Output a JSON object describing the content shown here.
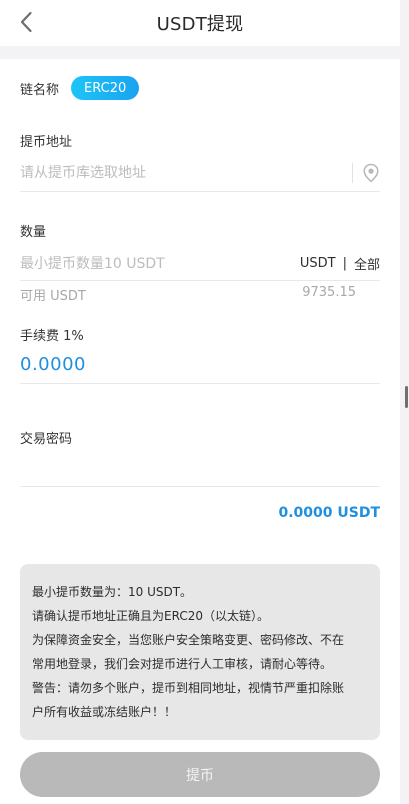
{
  "header": {
    "title": "USDT提现",
    "back_icon": "chevron-left-icon"
  },
  "chain": {
    "label": "链名称",
    "selected": "ERC20",
    "accent": "#1cb8f4"
  },
  "address": {
    "label": "提币地址",
    "placeholder": "请从提币库选取地址",
    "location_icon": "location-pin-icon"
  },
  "amount": {
    "label": "数量",
    "placeholder": "最小提币数量10 USDT",
    "currency": "USDT",
    "separator": "|",
    "all_label": "全部",
    "available_label": "可用 USDT",
    "available_value": "9735.15"
  },
  "fee": {
    "label": "手续费 1%",
    "value": "0.0000",
    "value_color": "#1f8fe0"
  },
  "password": {
    "label": "交易密码"
  },
  "total": {
    "value": "0.0000 USDT"
  },
  "notice": {
    "lines": [
      "最小提币数量为：10 USDT。",
      "请确认提币地址正确且为ERC20（以太链）。",
      "为保障资金安全，当您账户安全策略变更、密码修改、不在",
      "常用地登录，我们会对提币进行人工审核，请耐心等待。",
      "警告：请勿多个账户，提币到相同地址，视情节严重扣除账",
      "户所有收益或冻结账户！！"
    ]
  },
  "submit": {
    "label": "提币"
  }
}
